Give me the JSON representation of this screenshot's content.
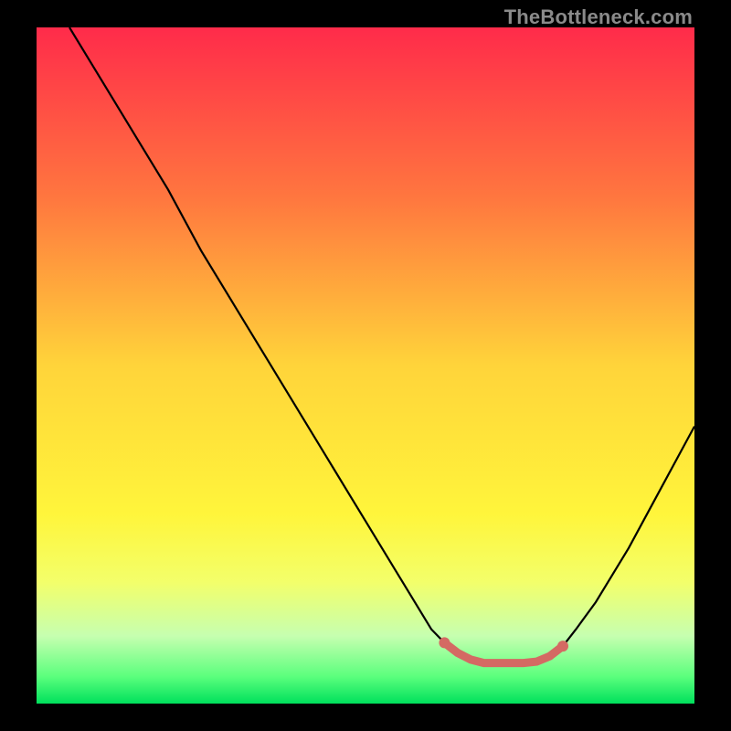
{
  "watermark": "TheBottleneck.com",
  "chart_data": {
    "type": "line",
    "title": "",
    "xlabel": "",
    "ylabel": "",
    "xlim": [
      0,
      100
    ],
    "ylim": [
      0,
      100
    ],
    "grid": false,
    "legend": false,
    "background_gradient": {
      "stops": [
        {
          "offset": 0.0,
          "color": "#ff2b4a"
        },
        {
          "offset": 0.25,
          "color": "#ff763f"
        },
        {
          "offset": 0.5,
          "color": "#ffd43a"
        },
        {
          "offset": 0.72,
          "color": "#fff53b"
        },
        {
          "offset": 0.82,
          "color": "#f3ff6a"
        },
        {
          "offset": 0.9,
          "color": "#c6ffb0"
        },
        {
          "offset": 0.96,
          "color": "#5bff7d"
        },
        {
          "offset": 1.0,
          "color": "#00e05c"
        }
      ]
    },
    "series": [
      {
        "name": "bottleneck-curve",
        "color": "#000000",
        "x": [
          5,
          10,
          15,
          20,
          25,
          30,
          35,
          40,
          45,
          50,
          55,
          60,
          62,
          64,
          66,
          68,
          70,
          72,
          74,
          76,
          78,
          80,
          82,
          85,
          90,
          95,
          100
        ],
        "y": [
          100,
          92,
          84,
          76,
          67,
          59,
          51,
          43,
          35,
          27,
          19,
          11,
          9,
          7.5,
          6.5,
          6,
          6,
          6,
          6,
          6.2,
          7,
          8.5,
          11,
          15,
          23,
          32,
          41
        ]
      }
    ],
    "highlight": {
      "name": "sweet-spot",
      "color": "#d46a63",
      "points": [
        {
          "x": 62,
          "y": 9
        },
        {
          "x": 64,
          "y": 7.5
        },
        {
          "x": 66,
          "y": 6.5
        },
        {
          "x": 68,
          "y": 6
        },
        {
          "x": 70,
          "y": 6
        },
        {
          "x": 72,
          "y": 6
        },
        {
          "x": 74,
          "y": 6
        },
        {
          "x": 76,
          "y": 6.2
        },
        {
          "x": 78,
          "y": 7
        },
        {
          "x": 80,
          "y": 8.5
        }
      ]
    }
  }
}
